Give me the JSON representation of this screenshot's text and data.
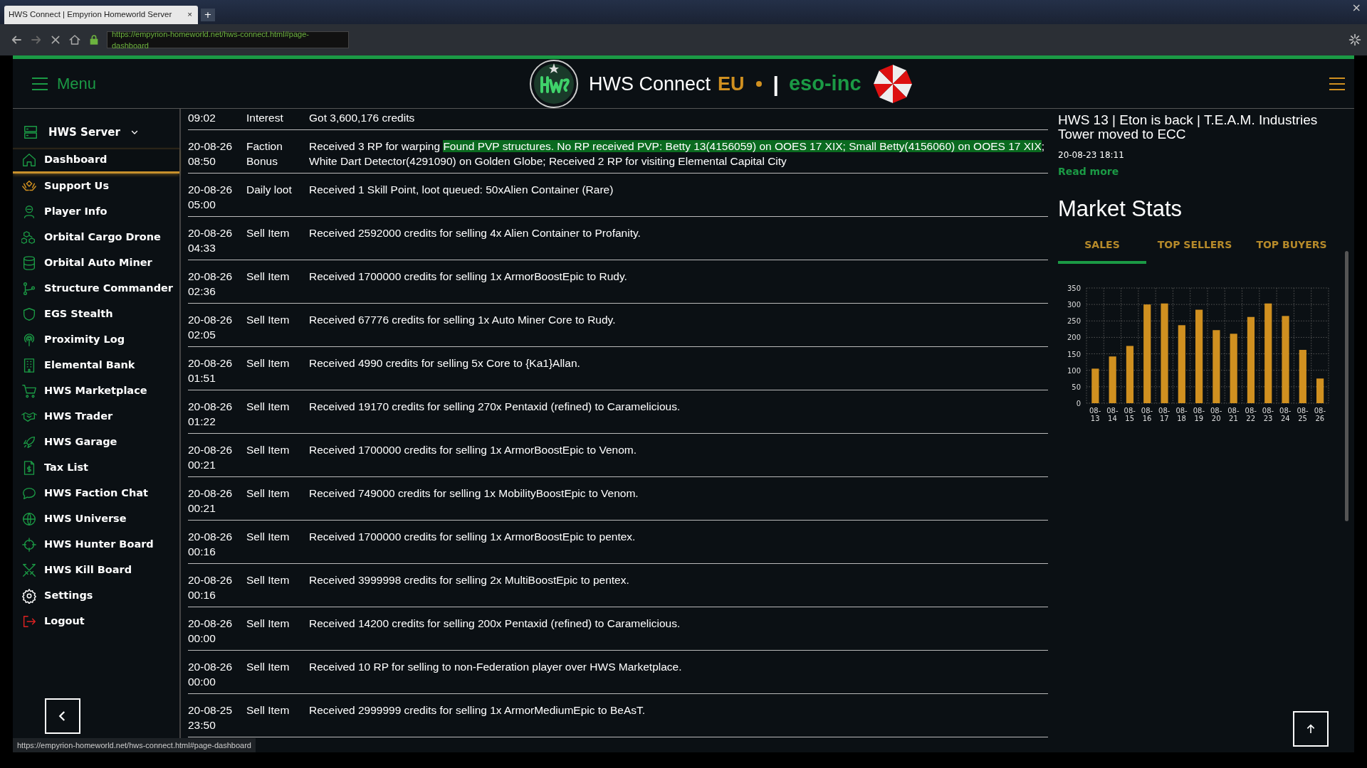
{
  "browser": {
    "tab_title": "HWS Connect | Empyrion Homeworld Server",
    "tab_close": "×",
    "new_tab": "+",
    "url": "https://empyrion-homeworld.net/hws-connect.html#page-dashboard",
    "window_close": "×",
    "status_url": "https://empyrion-homeworld.net/hws-connect.html#page-dashboard"
  },
  "header": {
    "menu_label": "Menu",
    "title": "HWS Connect",
    "region": "EU",
    "separator": "|",
    "faction": "eso-inc"
  },
  "sidebar": {
    "server": "HWS Server",
    "items": [
      {
        "label": "Dashboard",
        "selected": true
      },
      {
        "label": "Support Us",
        "selected": false
      },
      {
        "label": "Player Info",
        "selected": false
      },
      {
        "label": "Orbital Cargo Drone",
        "selected": false
      },
      {
        "label": "Orbital Auto Miner",
        "selected": false
      },
      {
        "label": "Structure Commander",
        "selected": false
      },
      {
        "label": "EGS Stealth",
        "selected": false
      },
      {
        "label": "Proximity Log",
        "selected": false
      },
      {
        "label": "Elemental Bank",
        "selected": false
      },
      {
        "label": "HWS Marketplace",
        "selected": false
      },
      {
        "label": "HWS Trader",
        "selected": false
      },
      {
        "label": "HWS Garage",
        "selected": false
      },
      {
        "label": "Tax List",
        "selected": false
      },
      {
        "label": "HWS Faction Chat",
        "selected": false
      },
      {
        "label": "HWS Universe",
        "selected": false
      },
      {
        "label": "HWS Hunter Board",
        "selected": false
      },
      {
        "label": "HWS Kill Board",
        "selected": false
      },
      {
        "label": "Settings",
        "selected": false
      },
      {
        "label": "Logout",
        "selected": false
      }
    ]
  },
  "log": [
    {
      "date": "09:02",
      "type": "Interest",
      "details": [
        {
          "text": "Got 3,600,176 credits",
          "highlighted": false
        }
      ]
    },
    {
      "date": "20-08-26 08:50",
      "type": "Faction Bonus",
      "details": [
        {
          "text": "Received 3 RP for warping ",
          "highlighted": false
        },
        {
          "text": "Found PVP structures. No RP received PVP: Betty 13(4156059) on OOES 17 XIX; Small Betty(4156060) on OOES 17 XIX",
          "highlighted": true
        },
        {
          "text": "; White Dart Detector(4291090) on Golden Globe; Received 2 RP for visiting Elemental Capital City",
          "highlighted": false
        }
      ]
    },
    {
      "date": "20-08-26 05:00",
      "type": "Daily loot",
      "details": [
        {
          "text": "Received 1 Skill Point, loot queued: 50xAlien Container (Rare)",
          "highlighted": false
        }
      ]
    },
    {
      "date": "20-08-26 04:33",
      "type": "Sell Item",
      "details": [
        {
          "text": "Received 2592000 credits for selling 4x Alien Container to Profanity.",
          "highlighted": false
        }
      ]
    },
    {
      "date": "20-08-26 02:36",
      "type": "Sell Item",
      "details": [
        {
          "text": "Received 1700000 credits for selling 1x ArmorBoostEpic to Rudy.",
          "highlighted": false
        }
      ]
    },
    {
      "date": "20-08-26 02:05",
      "type": "Sell Item",
      "details": [
        {
          "text": "Received 67776 credits for selling 1x Auto Miner Core to Rudy.",
          "highlighted": false
        }
      ]
    },
    {
      "date": "20-08-26 01:51",
      "type": "Sell Item",
      "details": [
        {
          "text": "Received 4990 credits for selling 5x Core to {Ka1}Allan.",
          "highlighted": false
        }
      ]
    },
    {
      "date": "20-08-26 01:22",
      "type": "Sell Item",
      "details": [
        {
          "text": "Received 19170 credits for selling 270x Pentaxid (refined) to Caramelicious.",
          "highlighted": false
        }
      ]
    },
    {
      "date": "20-08-26 00:21",
      "type": "Sell Item",
      "details": [
        {
          "text": "Received 1700000 credits for selling 1x ArmorBoostEpic to Venom.",
          "highlighted": false
        }
      ]
    },
    {
      "date": "20-08-26 00:21",
      "type": "Sell Item",
      "details": [
        {
          "text": "Received 749000 credits for selling 1x MobilityBoostEpic to Venom.",
          "highlighted": false
        }
      ]
    },
    {
      "date": "20-08-26 00:16",
      "type": "Sell Item",
      "details": [
        {
          "text": "Received 1700000 credits for selling 1x ArmorBoostEpic to pentex.",
          "highlighted": false
        }
      ]
    },
    {
      "date": "20-08-26 00:16",
      "type": "Sell Item",
      "details": [
        {
          "text": "Received 3999998 credits for selling 2x MultiBoostEpic to pentex.",
          "highlighted": false
        }
      ]
    },
    {
      "date": "20-08-26 00:00",
      "type": "Sell Item",
      "details": [
        {
          "text": "Received 14200 credits for selling 200x Pentaxid (refined) to Caramelicious.",
          "highlighted": false
        }
      ]
    },
    {
      "date": "20-08-26 00:00",
      "type": "Sell Item",
      "details": [
        {
          "text": "Received 10 RP for selling to non-Federation player over HWS Marketplace.",
          "highlighted": false
        }
      ]
    },
    {
      "date": "20-08-25 23:50",
      "type": "Sell Item",
      "details": [
        {
          "text": "Received 2999999 credits for selling 1x ArmorMediumEpic to BeAsT.",
          "highlighted": false
        }
      ]
    }
  ],
  "news": {
    "title": "HWS 13 | Eton is back | T.E.A.M. Industries Tower moved to ECC",
    "date": "20-08-23 18:11",
    "link": "Read more"
  },
  "market": {
    "title": "Market Stats",
    "tabs": [
      {
        "label": "SALES",
        "selected": true
      },
      {
        "label": "TOP SELLERS",
        "selected": false
      },
      {
        "label": "TOP BUYERS",
        "selected": false
      }
    ],
    "chart_data": {
      "type": "bar",
      "categories": [
        "08-13",
        "08-14",
        "08-15",
        "08-16",
        "08-17",
        "08-18",
        "08-19",
        "08-20",
        "08-21",
        "08-22",
        "08-23",
        "08-24",
        "08-25",
        "08-26"
      ],
      "grid": true,
      "series": [
        {
          "color": "#d09020",
          "values": [
            105,
            142,
            174,
            300,
            303,
            237,
            284,
            222,
            211,
            262,
            303,
            265,
            162,
            75
          ]
        }
      ],
      "ylim": [
        0,
        350
      ],
      "yticks": [
        0,
        50,
        100,
        150,
        200,
        250,
        300,
        350
      ]
    }
  }
}
